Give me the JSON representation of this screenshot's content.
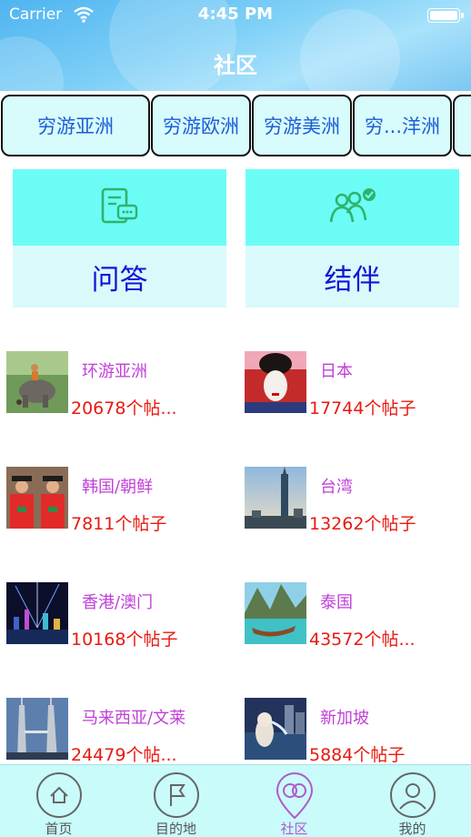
{
  "status_bar": {
    "carrier": "Carrier",
    "time": "4:45 PM"
  },
  "header": {
    "title": "社区"
  },
  "region_tabs": [
    {
      "label": "穷游亚洲"
    },
    {
      "label": "穷游欧洲"
    },
    {
      "label": "穷游美洲"
    },
    {
      "label": "穷...洋洲"
    },
    {
      "label": ""
    }
  ],
  "features": [
    {
      "label": "问答",
      "icon": "chat-document-icon"
    },
    {
      "label": "结伴",
      "icon": "people-group-icon"
    }
  ],
  "destinations": [
    {
      "name": "环游亚洲",
      "count": "20678个帖...",
      "thumb": "elephant-photo"
    },
    {
      "name": "日本",
      "count": "17744个帖子",
      "thumb": "geisha-photo"
    },
    {
      "name": "韩国/朝鲜",
      "count": "7811个帖子",
      "thumb": "korean-guards-photo"
    },
    {
      "name": "台湾",
      "count": "13262个帖子",
      "thumb": "taipei-101-photo"
    },
    {
      "name": "香港/澳门",
      "count": "10168个帖子",
      "thumb": "hong-kong-night-photo"
    },
    {
      "name": "泰国",
      "count": "43572个帖...",
      "thumb": "thai-longboat-photo"
    },
    {
      "name": "马来西亚/文莱",
      "count": "24479个帖...",
      "thumb": "petronas-towers-photo"
    },
    {
      "name": "新加坡",
      "count": "5884个帖子",
      "thumb": "merlion-photo"
    }
  ],
  "tab_bar": [
    {
      "label": "首页",
      "icon": "home-icon",
      "active": false
    },
    {
      "label": "目的地",
      "icon": "flag-icon",
      "active": false
    },
    {
      "label": "社区",
      "icon": "community-icon",
      "active": true
    },
    {
      "label": "我的",
      "icon": "profile-icon",
      "active": false
    }
  ],
  "colors": {
    "accent_cyan": "#6cfcf6",
    "tab_text": "#1d5ed8",
    "feature_text": "#1414d8",
    "dest_name": "#c13fd9",
    "dest_count": "#e8190f",
    "active_tab": "#b05ac8"
  }
}
